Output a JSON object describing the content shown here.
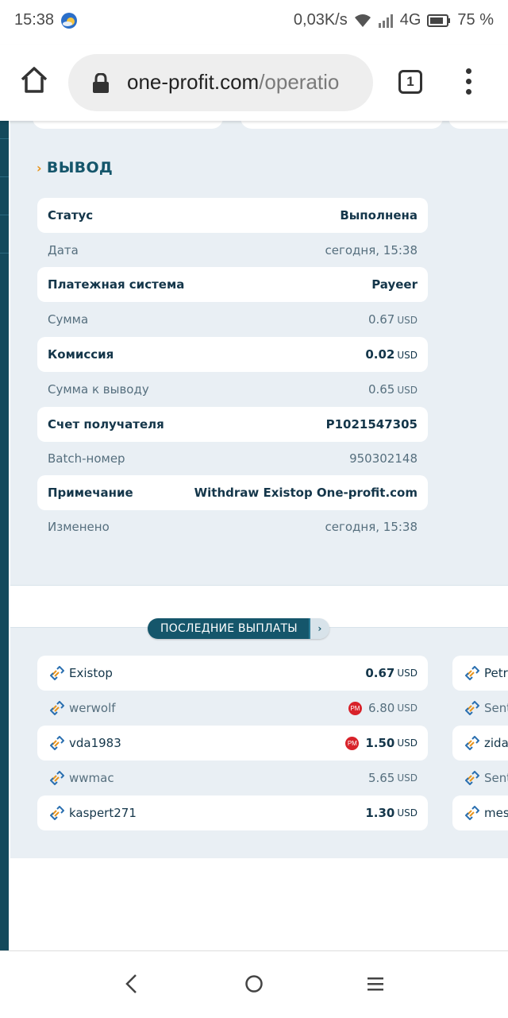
{
  "status_bar": {
    "time": "15:38",
    "net_speed": "0,03K/s",
    "network": "4G",
    "battery": "75 %",
    "icons": [
      "weather-icon",
      "wifi-icon",
      "signal-icon",
      "battery-icon"
    ]
  },
  "browser": {
    "url_domain": "one-profit.com",
    "url_path": "/operatio",
    "tab_count": "1",
    "icons": [
      "home-icon",
      "lock-icon",
      "menu-dots-icon"
    ]
  },
  "withdrawal": {
    "title": "ВЫВОД",
    "rows": [
      {
        "label": "Статус",
        "value": "Выполнена",
        "unit": ""
      },
      {
        "label": "Дата",
        "value": "сегодня, 15:38",
        "unit": ""
      },
      {
        "label": "Платежная система",
        "value": "Payeer",
        "unit": ""
      },
      {
        "label": "Сумма",
        "value": "0.67",
        "unit": "USD"
      },
      {
        "label": "Комиссия",
        "value": "0.02",
        "unit": "USD"
      },
      {
        "label": "Сумма к выводу",
        "value": "0.65",
        "unit": "USD"
      },
      {
        "label": "Счет получателя",
        "value": "P1021547305",
        "unit": ""
      },
      {
        "label": "Batch-номер",
        "value": "950302148",
        "unit": ""
      },
      {
        "label": "Примечание",
        "value": "Withdraw Existop One-profit.com",
        "unit": ""
      },
      {
        "label": "Изменено",
        "value": "сегодня, 15:38",
        "unit": ""
      }
    ]
  },
  "payouts": {
    "button_label": "ПОСЛЕДНИЕ ВЫПЛАТЫ",
    "arrow": "›",
    "items": [
      {
        "user": "Existop",
        "amount": "0.67",
        "unit": "USD",
        "badge": ""
      },
      {
        "user": "werwolf",
        "amount": "6.80",
        "unit": "USD",
        "badge": "PM"
      },
      {
        "user": "vda1983",
        "amount": "1.50",
        "unit": "USD",
        "badge": "PM"
      },
      {
        "user": "wwmac",
        "amount": "5.65",
        "unit": "USD",
        "badge": ""
      },
      {
        "user": "kaspert271",
        "amount": "1.30",
        "unit": "USD",
        "badge": ""
      }
    ],
    "next_column": [
      "Petr",
      "Sentv",
      "zidar",
      "Sentv",
      "mes"
    ]
  },
  "nav": {
    "icons": [
      "back-icon",
      "home-circle-icon",
      "recents-icon"
    ]
  },
  "colors": {
    "accent": "#15566b",
    "page_bg": "#e9eff4",
    "bullet": "#e8941b",
    "pm_badge": "#d8222a"
  }
}
